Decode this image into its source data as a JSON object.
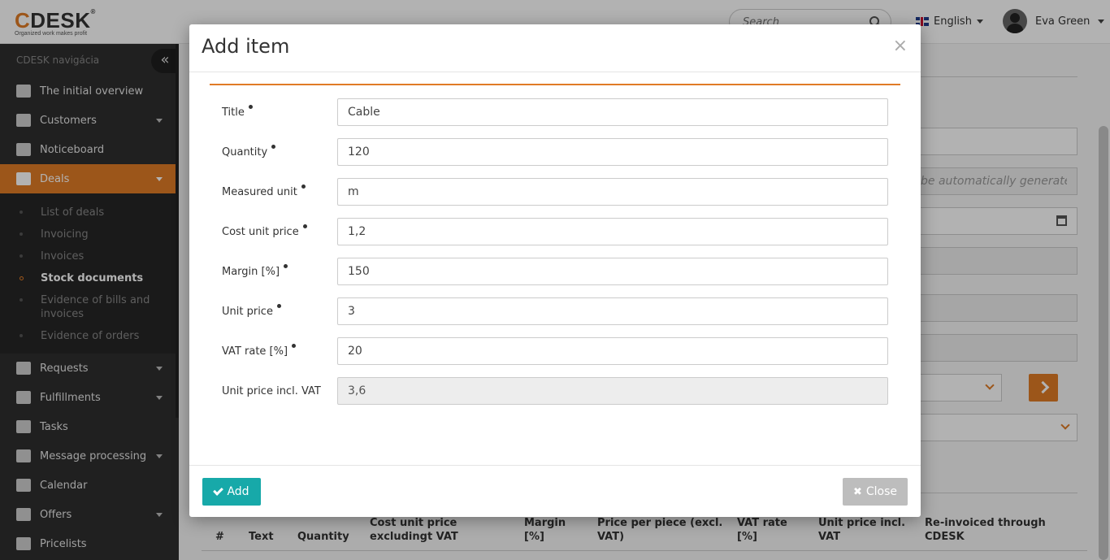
{
  "brand": {
    "logo_c": "C",
    "logo_rest": "DESK",
    "registered": "®",
    "tagline": "Organized work makes profit"
  },
  "header": {
    "search_placeholder": "Search",
    "language": "English",
    "user_name": "Eva Green"
  },
  "sidebar": {
    "header": "CDESK navigácia",
    "collapse_glyph": "«",
    "items_top": [
      {
        "label": "The initial overview",
        "icon": "bar-chart-icon"
      },
      {
        "label": "Customers",
        "icon": "user-icon"
      },
      {
        "label": "Noticeboard",
        "icon": "send-icon"
      },
      {
        "label": "Deals",
        "icon": "briefcase-icon"
      }
    ],
    "deals_submenu": [
      "List of deals",
      "Invoicing",
      "Invoices",
      "Stock documents",
      "Evidence of bills and invoices",
      "Evidence of orders"
    ],
    "items_bottom": [
      {
        "label": "Requests",
        "icon": "check-circle-icon"
      },
      {
        "label": "Fulfillments",
        "icon": "box-icon"
      },
      {
        "label": "Tasks",
        "icon": "list-icon"
      },
      {
        "label": "Message processing",
        "icon": "envelope-icon"
      },
      {
        "label": "Calendar",
        "icon": "calendar-icon"
      },
      {
        "label": "Offers",
        "icon": "gift-icon"
      },
      {
        "label": "Pricelists",
        "icon": "file-icon"
      }
    ]
  },
  "background_form": {
    "auto_placeholder": "be automatically generate"
  },
  "table": {
    "headers": [
      "#",
      "Text",
      "Quantity",
      "Cost unit price excludingt VAT",
      "Margin [%]",
      "Price per piece (excl. VAT)",
      "VAT rate [%]",
      "Unit price incl. VAT",
      "Re-invoiced through CDESK"
    ]
  },
  "modal": {
    "title": "Add item",
    "close_glyph": "×",
    "fields": [
      {
        "label": "Title",
        "value": "Cable",
        "required": true
      },
      {
        "label": "Quantity",
        "value": "120",
        "required": true
      },
      {
        "label": "Measured unit",
        "value": "m",
        "required": true
      },
      {
        "label": "Cost unit price",
        "value": "1,2",
        "required": true
      },
      {
        "label": "Margin [%]",
        "value": "150",
        "required": true
      },
      {
        "label": "Unit price",
        "value": "3",
        "required": true
      },
      {
        "label": "VAT rate [%]",
        "value": "20",
        "required": true
      },
      {
        "label": "Unit price incl. VAT",
        "value": "3,6",
        "required": false,
        "readonly": true
      }
    ],
    "add_label": "Add",
    "close_label": "Close"
  },
  "colors": {
    "accent": "#e07b26",
    "primary": "#17a9a9",
    "sidebar": "#2f2f2f"
  }
}
